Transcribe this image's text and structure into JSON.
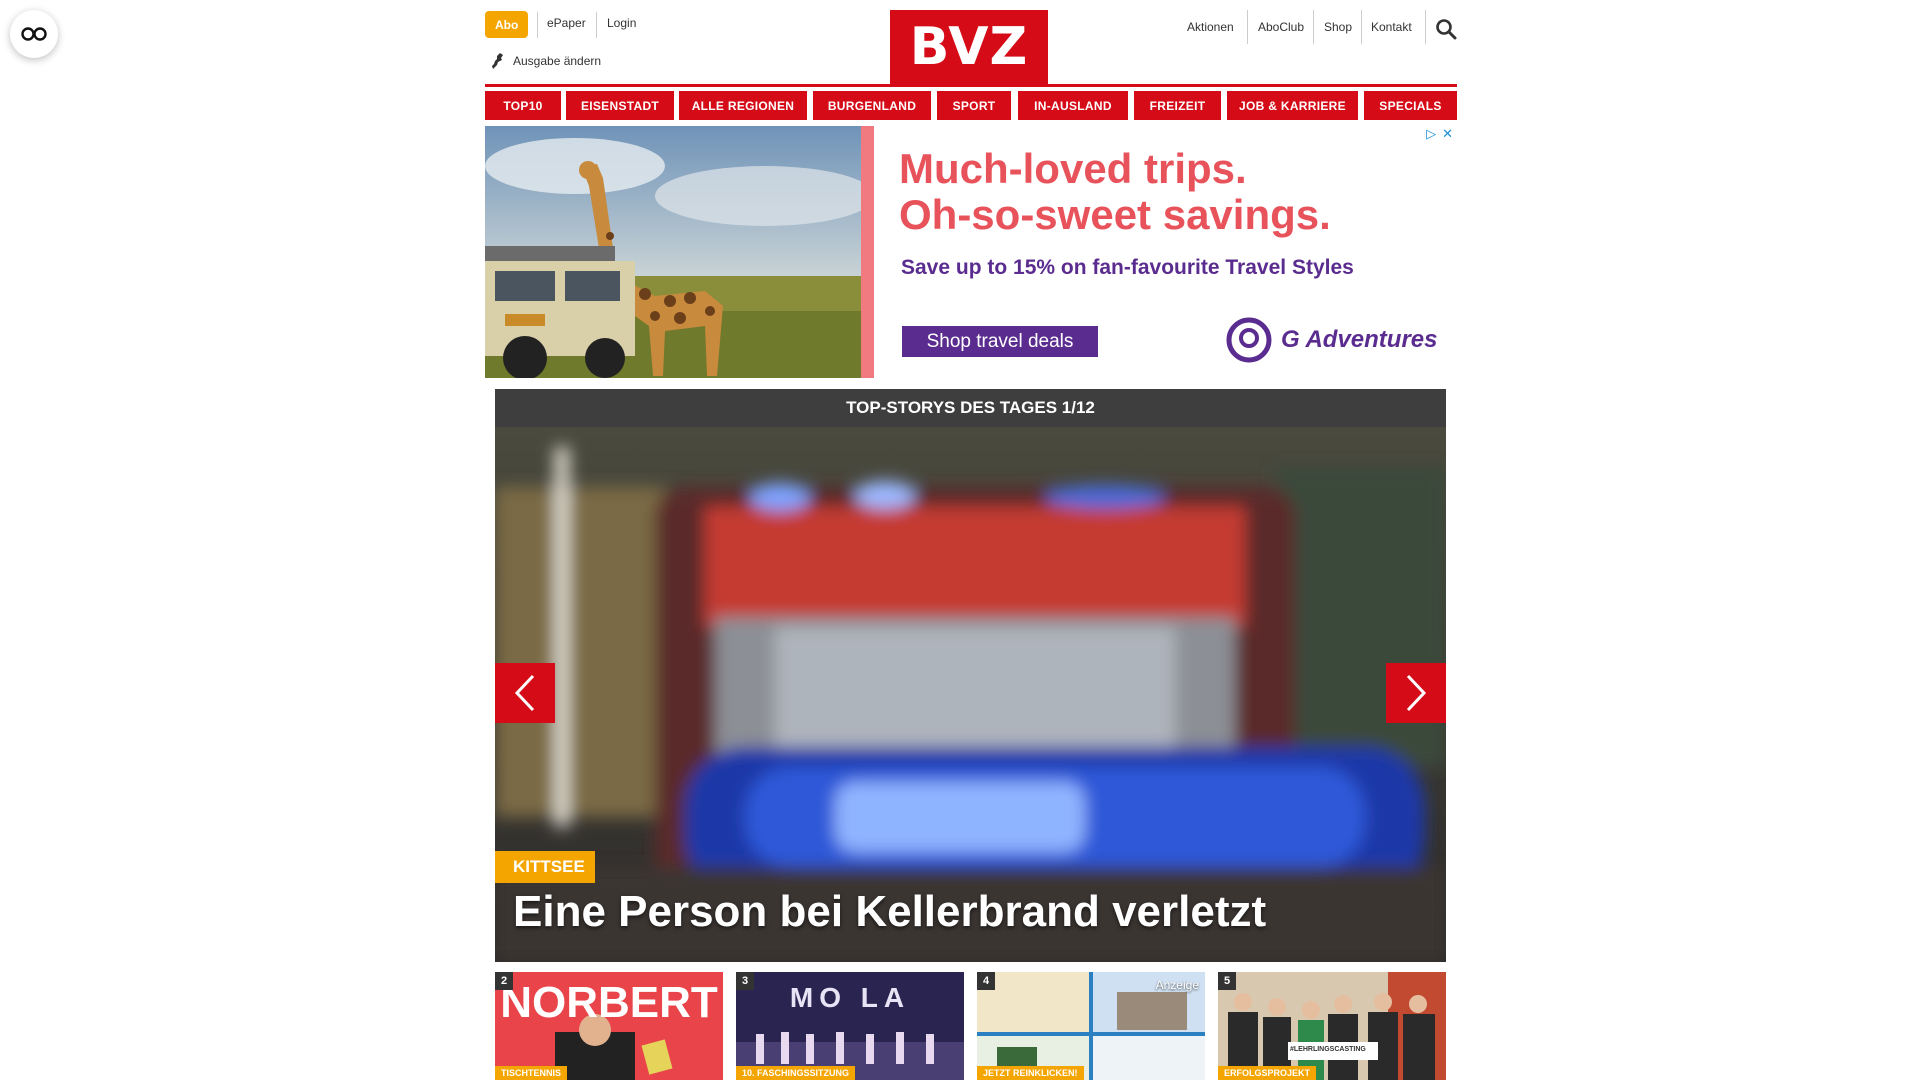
{
  "topbar": {
    "abo": "Abo",
    "epaper": "ePaper",
    "login": "Login",
    "ausgabe": "Ausgabe ändern",
    "logo": "BVZ",
    "right_links": [
      "Aktionen",
      "AboClub",
      "Shop",
      "Kontakt"
    ]
  },
  "nav": [
    "TOP10",
    "EISENSTADT",
    "ALLE REGIONEN",
    "BURGENLAND",
    "SPORT",
    "IN-AUSLAND",
    "FREIZEIT",
    "JOB & KARRIERE",
    "SPECIALS"
  ],
  "ad": {
    "headline1": "Much-loved trips.",
    "headline2": "Oh-so-sweet savings.",
    "subline": "Save up to 15% on fan-favourite Travel Styles",
    "button": "Shop travel deals",
    "brand": "G Adventures"
  },
  "slider": {
    "header": "TOP-STORYS DES TAGES 1/12",
    "kicker": "KITTSEE",
    "headline": "Eine Person bei Kellerbrand verletzt"
  },
  "thumbs": [
    {
      "num": "2",
      "label": "TISCHTENNIS",
      "text": "NORBERT"
    },
    {
      "num": "3",
      "label": "10. FASCHINGSSITZUNG",
      "text": "MO LA"
    },
    {
      "num": "4",
      "label": "JETZT REINKLICKEN!",
      "extra": "Anzeige"
    },
    {
      "num": "5",
      "label": "ERFOLGSPROJEKT",
      "extra": "#LEHRLINGSCASTING"
    }
  ],
  "colors": {
    "brand_red": "#d50c17",
    "accent_orange": "#f5a500",
    "ad_purple": "#5b2c8f",
    "ad_coral": "#e8525a"
  }
}
